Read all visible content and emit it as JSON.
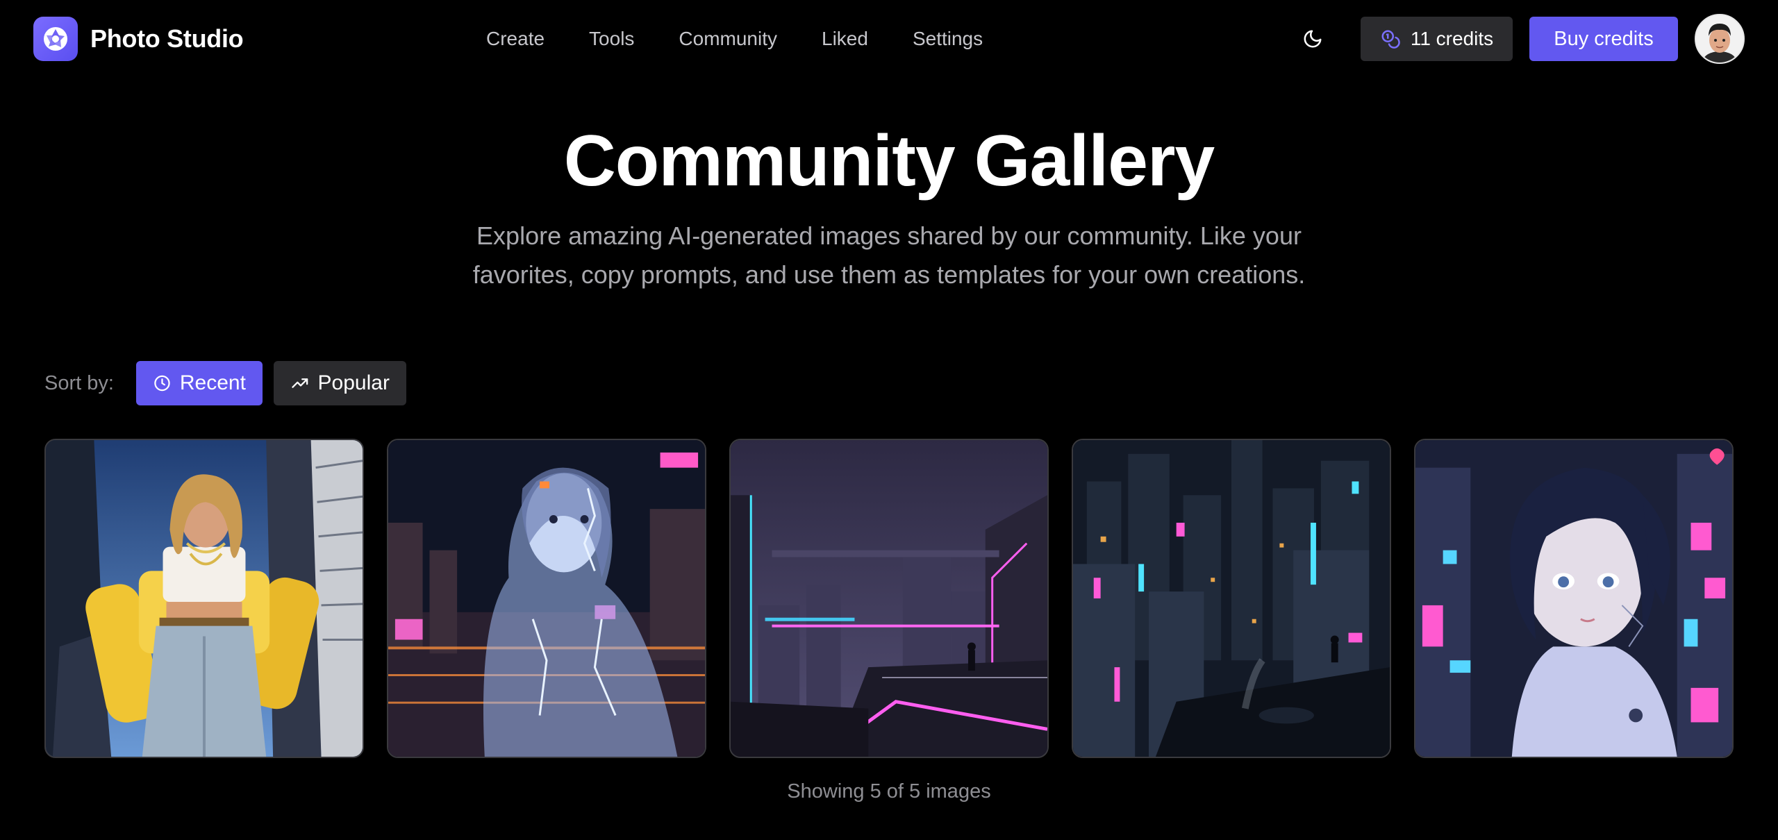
{
  "app": {
    "name": "Photo Studio",
    "logo_icon": "camera-aperture-icon",
    "accent_color": "#6258f0"
  },
  "nav": {
    "items": [
      {
        "label": "Create"
      },
      {
        "label": "Tools"
      },
      {
        "label": "Community"
      },
      {
        "label": "Liked"
      },
      {
        "label": "Settings"
      }
    ]
  },
  "header": {
    "theme_icon": "moon-icon",
    "credits_icon": "coins-icon",
    "credits_label": "11 credits",
    "buy_label": "Buy credits",
    "avatar_icon": "user-avatar"
  },
  "hero": {
    "title": "Community Gallery",
    "subtitle_line1": "Explore amazing AI-generated images shared by our community. Like your",
    "subtitle_line2": "favorites, copy prompts, and use them as templates for your own creations."
  },
  "sort": {
    "label": "Sort by:",
    "options": [
      {
        "label": "Recent",
        "icon": "clock-icon",
        "active": true
      },
      {
        "label": "Popular",
        "icon": "trending-up-icon",
        "active": false
      }
    ]
  },
  "gallery": {
    "images": [
      {
        "subject": "woman in yellow jacket among skyscrapers"
      },
      {
        "subject": "holographic cyborg woman in neon city"
      },
      {
        "subject": "purple futuristic city with neon rooftop"
      },
      {
        "subject": "rainy night cyberpunk cityscape"
      },
      {
        "subject": "anime cyborg girl with neon signs",
        "liked": true
      }
    ]
  },
  "footer": {
    "count_text": "Showing 5 of 5 images"
  }
}
